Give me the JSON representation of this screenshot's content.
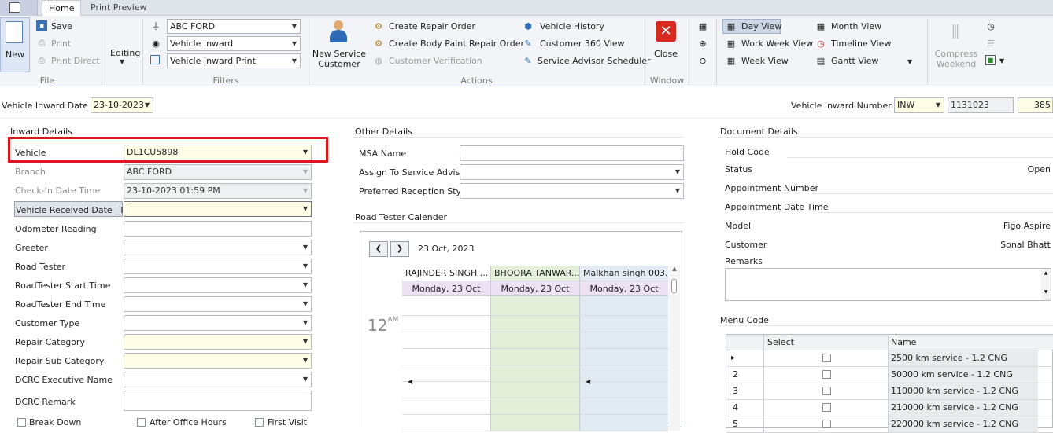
{
  "tabs": {
    "home": "Home",
    "print_preview": "Print Preview"
  },
  "file": {
    "new": "New",
    "save": "Save",
    "print": "Print",
    "print_direct": "Print Direct",
    "editing": "Editing",
    "group": "File"
  },
  "filters": {
    "dealer": "ABC FORD",
    "module": "Vehicle Inward",
    "report": "Vehicle Inward Print",
    "group": "Filters"
  },
  "actions": {
    "new_service_customer_1": "New Service",
    "new_service_customer_2": "Customer",
    "create_repair_order": "Create Repair Order",
    "create_body_paint": "Create Body  Paint Repair Order",
    "customer_verification": "Customer Verification",
    "vehicle_history": "Vehicle History",
    "customer_360": "Customer 360 View",
    "service_advisor_scheduler": "Service Advisor Scheduler",
    "group": "Actions"
  },
  "window": {
    "close": "Close",
    "group": "Window"
  },
  "views": {
    "day": "Day View",
    "work_week": "Work Week View",
    "week": "Week View",
    "month": "Month View",
    "timeline": "Timeline View",
    "gantt": "Gantt View",
    "compress_1": "Compress",
    "compress_2": "Weekend"
  },
  "header": {
    "inward_date_label": "Vehicle Inward Date",
    "inward_date": "23-10-2023",
    "inward_number_label": "Vehicle Inward Number",
    "prefix": "INW",
    "number": "1131023",
    "suffix": "385"
  },
  "inward": {
    "title": "Inward Details",
    "vehicle_label": "Vehicle",
    "vehicle": "DL1CU5898",
    "branch_label": "Branch",
    "branch": "ABC FORD",
    "checkin_label": "Check-In Date Time",
    "checkin": "23-10-2023 01:59 PM",
    "received_label": "Vehicle Received Date _Time",
    "odometer_label": "Odometer Reading",
    "greeter_label": "Greeter",
    "road_tester_label": "Road Tester",
    "rt_start_label": "RoadTester Start Time",
    "rt_end_label": "RoadTester End Time",
    "customer_type_label": "Customer Type",
    "repair_cat_label": "Repair Category",
    "repair_sub_label": "Repair Sub Category",
    "dcrc_exec_label": "DCRC Executive Name",
    "dcrc_remark_label": "DCRC Remark",
    "break_down": "Break Down",
    "after_office": "After Office Hours",
    "first_visit": "First Visit"
  },
  "other": {
    "title": "Other Details",
    "msa_label": "MSA Name",
    "assign_label": "Assign To Service Advisor",
    "pref_label": "Preferred Reception Style",
    "calendar_title": "Road Tester Calender"
  },
  "calendar": {
    "date": "23 Oct, 2023",
    "hour": "12",
    "ampm": "AM",
    "columns": [
      {
        "name": "RAJINDER  SINGH ...",
        "day": "Monday, 23 Oct"
      },
      {
        "name": "BHOORA  TANWAR...",
        "day": "Monday, 23 Oct"
      },
      {
        "name": "Malkhan  singh 003...",
        "day": "Monday, 23 Oct"
      }
    ]
  },
  "document": {
    "title": "Document Details",
    "hold_label": "Hold Code",
    "status_label": "Status",
    "status": "Open",
    "appt_no_label": "Appointment Number",
    "appt_dt_label": "Appointment Date Time",
    "model_label": "Model",
    "model": "Figo Aspire",
    "customer_label": "Customer",
    "customer": "Sonal Bhatt",
    "remarks_label": "Remarks"
  },
  "menu": {
    "title": "Menu Code",
    "col_select": "Select",
    "col_name": "Name",
    "rows": [
      {
        "no": "",
        "name": "2500   km service - 1.2 CNG"
      },
      {
        "no": "2",
        "name": "50000 km service - 1.2 CNG"
      },
      {
        "no": "3",
        "name": "110000 km service - 1.2 CNG"
      },
      {
        "no": "4",
        "name": "210000 km service - 1.2 CNG"
      },
      {
        "no": "5",
        "name": "220000 km service - 1.2 CNG"
      }
    ]
  },
  "colors": {
    "highlight": "#e0161d",
    "ribbon_bg": "#f3f4f7",
    "yellow": "#fffde6",
    "green_col": "#e4efd9",
    "blue_col": "#e3ebf2",
    "purple_hdr": "#ece2f3"
  }
}
